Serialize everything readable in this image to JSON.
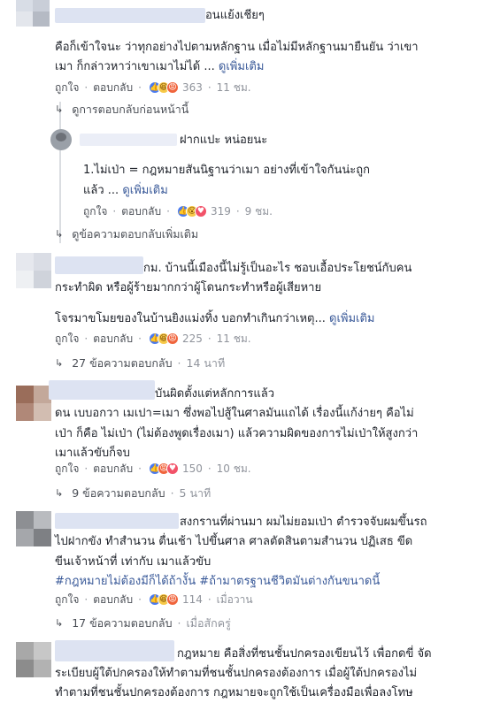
{
  "comments": [
    {
      "name_suffix": "อนแย้งเชียๆ",
      "lines": [
        "คือก็เข้าใจนะ ว่าทุกอย่างไปตามหลักฐาน เมื่อไม่มีหลักฐานมายืนยัน ว่าเขา",
        "เมา ก็กล่าวหาว่าเขาเมาไม่ได้ ..."
      ],
      "see_more": "ดูเพิ่มเติม",
      "like": "ถูกใจ",
      "reply": "ตอบกลับ",
      "reactions": [
        "like-icon",
        "haha-icon",
        "angry-icon"
      ],
      "reaction_count": "363",
      "time": "11 ชม."
    },
    {
      "name_suffix": "ฝากแปะ หน่อยนะ",
      "lines": [
        "1.ไม่เป่า = กฎหมายสันนิฐานว่าเมา อย่างที่เข้าใจกันน่ะถูก",
        "แล้ว ..."
      ],
      "see_more": "ดูเพิ่มเติม",
      "like": "ถูกใจ",
      "reply": "ตอบกลับ",
      "reactions": [
        "like-icon",
        "wow-icon",
        "love-icon"
      ],
      "reaction_count": "319",
      "time": "9 ชม."
    },
    {
      "name_suffix": "กม. บ้านนี้เมืองนี้ไม่รู้เป็นอะไร ชอบเอื้อประโยชน์กับคน",
      "lines": [
        "กระทำผิด หรือผู้ร้ายมากกว่าผู้โดนกระทำหรือผู้เสียหาย",
        "",
        "โจรมาขโมยของในบ้านยิงแม่งทิ้ง บอกทำเกินกว่าเหตุ..."
      ],
      "see_more": "ดูเพิ่มเติม",
      "like": "ถูกใจ",
      "reply": "ตอบกลับ",
      "reactions": [
        "like-icon",
        "haha-icon",
        "angry-icon"
      ],
      "reaction_count": "225",
      "time": "11 ชม."
    },
    {
      "name_suffix": "บันผิดตั้งแต่หลักการแล้ว",
      "lines": [
        "ดน เบบอกวา  เมเปา=เมา ซึ่งพอไปสู้ในศาลมันแถได้ เรื่องนี้แก้ง่ายๆ คือไม่",
        "เป่า ก็คือ ไม่เป่า (ไม่ต้องพูดเรื่องเมา) แล้วความผิดของการไม่เป่าให้สูงกว่า",
        "เมาแล้วขับก็จบ"
      ],
      "see_more": "",
      "like": "ถูกใจ",
      "reply": "ตอบกลับ",
      "reactions": [
        "like-icon",
        "angry-icon",
        "love-icon"
      ],
      "reaction_count": "150",
      "time": "10 ชม."
    },
    {
      "name_suffix": "สงกรานที่ผ่านมา ผมไม่ยอมเป่า ตำรวจจับผมขึ้นรถ",
      "lines": [
        "ไปฝากขัง ทำสำนวน ตื่นเช้า ไปขึ้นศาล ศาลตัดสินตามสำนวน ปฏิเสธ ขีด",
        "ขีนเจ้าหน้าที่ เท่ากับ เมาแล้วขับ"
      ],
      "hashtags": "#กฎหมายไม่ต้องมีก็ได้ถ้างั้น #ถ้ามาตรฐานชีวิตมันต่างกันขนาดนี้",
      "see_more": "",
      "like": "ถูกใจ",
      "reply": "ตอบกลับ",
      "reactions": [
        "like-icon",
        "haha-icon",
        "angry-icon"
      ],
      "reaction_count": "114",
      "time": "เมื่อวาน"
    },
    {
      "name_suffix": "กฎหมาย คือสิ่งที่ชนชั้นปกครองเขียนไว้ เพื่อกดขี่ จัด",
      "lines": [
        "ระเบียบผู้ใต้ปกครองให้ทำตามที่ชนชั้นปกครองต้องการ เมื่อผู้ใต้ปกครองไม่",
        "ทำตามที่ชนชั้นปกครองต้องการ กฎหมายจะถูกใช้เป็นเครื่องมือเพื่อลงโทษ"
      ]
    }
  ],
  "reply_links": [
    {
      "text": "ดูการตอบกลับก่อนหน้านี้",
      "ago": ""
    },
    {
      "text": "ดูข้อความตอบกลับเพิ่มเติม",
      "ago": ""
    },
    {
      "text": "27 ข้อความตอบกลับ",
      "ago": "14 นาที"
    },
    {
      "text": "9 ข้อความตอบกลับ",
      "ago": "5 นาที"
    },
    {
      "text": "17 ข้อความตอบกลับ",
      "ago": "เมื่อสักครู่"
    }
  ],
  "colors": {
    "link": "#385898",
    "meta": "#90949c",
    "text": "#1d2129"
  }
}
